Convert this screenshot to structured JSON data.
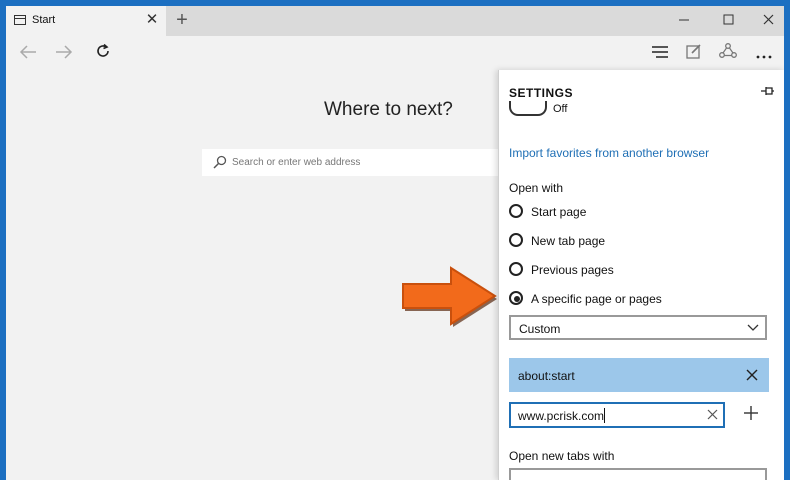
{
  "tab": {
    "title": "Start"
  },
  "page": {
    "heading": "Where to next?",
    "search_placeholder": "Search or enter web address"
  },
  "settings": {
    "title": "SETTINGS",
    "toggle_label": "Off",
    "import_link": "Import favorites from another browser",
    "open_with_label": "Open with",
    "open_with_options": [
      {
        "label": "Start page",
        "checked": false
      },
      {
        "label": "New tab page",
        "checked": false
      },
      {
        "label": "Previous pages",
        "checked": false
      },
      {
        "label": "A specific page or pages",
        "checked": true
      }
    ],
    "page_select_value": "Custom",
    "custom_pages": [
      "about:start"
    ],
    "url_input_value": "www.pcrisk.com",
    "open_new_tabs_label": "Open new tabs with"
  },
  "colors": {
    "accent": "#1f6fb5",
    "selected_item_bg": "#9cc7ea",
    "arrow": "#f26a1b"
  }
}
